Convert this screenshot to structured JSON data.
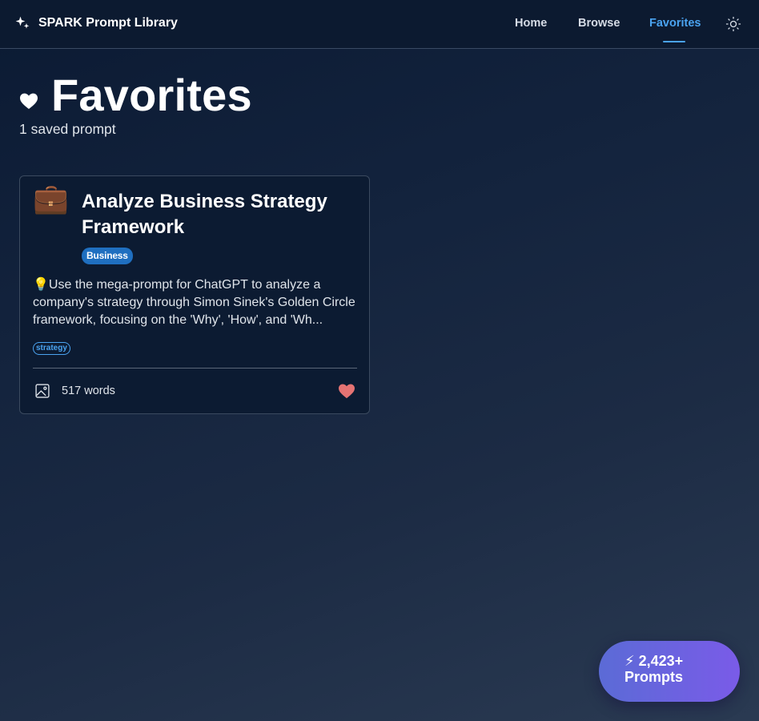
{
  "header": {
    "brand": "SPARK Prompt Library",
    "nav": {
      "home": "Home",
      "browse": "Browse",
      "favorites": "Favorites"
    },
    "active_nav": "Favorites",
    "accent_color": "#4aa3f0",
    "theme_toggle_icon": "sun-icon"
  },
  "page": {
    "title": "Favorites",
    "title_icon": "heart-icon",
    "subtitle": "1 saved prompt"
  },
  "cards": [
    {
      "emoji": "💼",
      "title": "Analyze Business Strategy Framework",
      "category": "Business",
      "description": "💡Use the mega-prompt for ChatGPT to analyze a company's strategy through Simon Sinek's Golden Circle framework, focusing on the 'Why', 'How', and 'Wh...",
      "tags": [
        "strategy"
      ],
      "media_icon": "image-icon",
      "word_count": "517 words",
      "favorited": true,
      "heart_color": "#e57373"
    }
  ],
  "floating_badge": {
    "line1": "⚡ 2,423+",
    "line2": "Prompts"
  }
}
